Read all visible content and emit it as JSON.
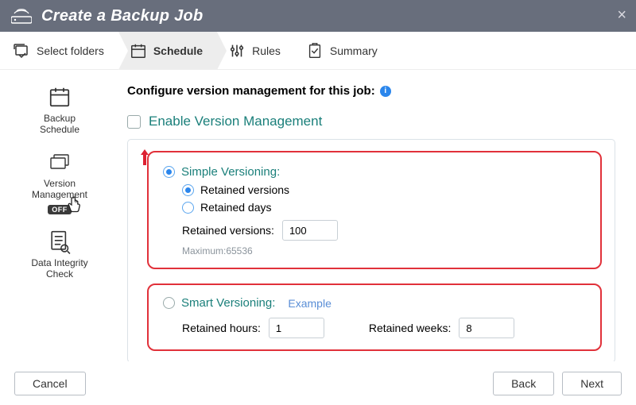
{
  "title": "Create a Backup Job",
  "close_label": "×",
  "steps": [
    {
      "label": "Select folders"
    },
    {
      "label": "Schedule"
    },
    {
      "label": "Rules"
    },
    {
      "label": "Summary"
    }
  ],
  "sidenav": {
    "backup_schedule": "Backup\nSchedule",
    "version_management": "Version\nManagement",
    "off_badge": "OFF",
    "data_integrity": "Data Integrity\nCheck"
  },
  "content": {
    "heading": "Configure version management for this job:",
    "enable_label": "Enable Version Management",
    "simple": {
      "title": "Simple Versioning:",
      "opt_versions": "Retained versions",
      "opt_days": "Retained days",
      "field_label": "Retained versions:",
      "field_value": "100",
      "max_note": "Maximum:65536"
    },
    "smart": {
      "title": "Smart Versioning:",
      "example": "Example",
      "hours_label": "Retained hours:",
      "hours_value": "1",
      "weeks_label": "Retained weeks:",
      "weeks_value": "8"
    }
  },
  "footer": {
    "cancel": "Cancel",
    "back": "Back",
    "next": "Next"
  }
}
